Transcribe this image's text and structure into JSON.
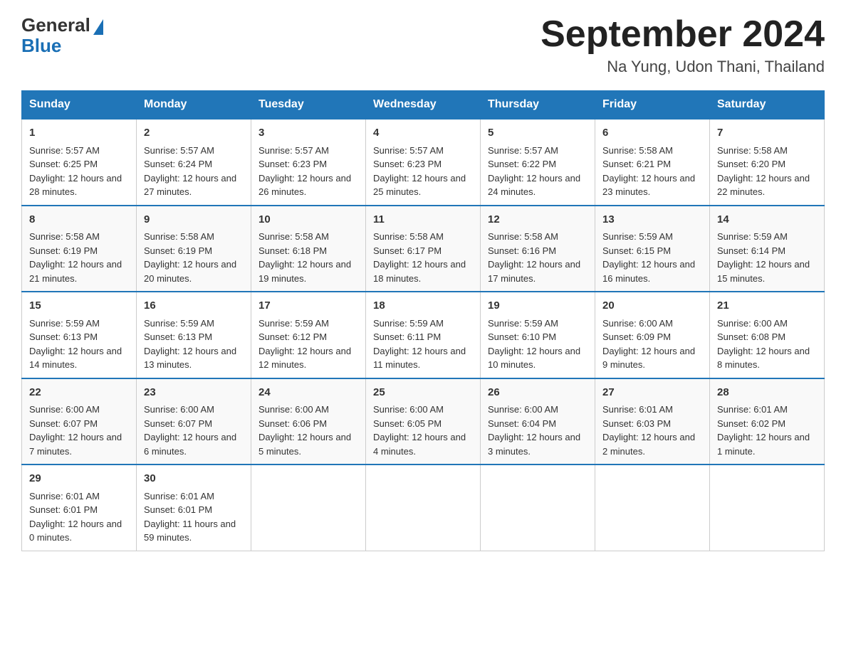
{
  "logo": {
    "general": "General",
    "blue": "Blue",
    "triangle_color": "#1a6fb5"
  },
  "header": {
    "title": "September 2024",
    "location": "Na Yung, Udon Thani, Thailand"
  },
  "weekdays": [
    "Sunday",
    "Monday",
    "Tuesday",
    "Wednesday",
    "Thursday",
    "Friday",
    "Saturday"
  ],
  "weeks": [
    [
      {
        "day": "1",
        "sunrise": "5:57 AM",
        "sunset": "6:25 PM",
        "daylight": "12 hours and 28 minutes."
      },
      {
        "day": "2",
        "sunrise": "5:57 AM",
        "sunset": "6:24 PM",
        "daylight": "12 hours and 27 minutes."
      },
      {
        "day": "3",
        "sunrise": "5:57 AM",
        "sunset": "6:23 PM",
        "daylight": "12 hours and 26 minutes."
      },
      {
        "day": "4",
        "sunrise": "5:57 AM",
        "sunset": "6:23 PM",
        "daylight": "12 hours and 25 minutes."
      },
      {
        "day": "5",
        "sunrise": "5:57 AM",
        "sunset": "6:22 PM",
        "daylight": "12 hours and 24 minutes."
      },
      {
        "day": "6",
        "sunrise": "5:58 AM",
        "sunset": "6:21 PM",
        "daylight": "12 hours and 23 minutes."
      },
      {
        "day": "7",
        "sunrise": "5:58 AM",
        "sunset": "6:20 PM",
        "daylight": "12 hours and 22 minutes."
      }
    ],
    [
      {
        "day": "8",
        "sunrise": "5:58 AM",
        "sunset": "6:19 PM",
        "daylight": "12 hours and 21 minutes."
      },
      {
        "day": "9",
        "sunrise": "5:58 AM",
        "sunset": "6:19 PM",
        "daylight": "12 hours and 20 minutes."
      },
      {
        "day": "10",
        "sunrise": "5:58 AM",
        "sunset": "6:18 PM",
        "daylight": "12 hours and 19 minutes."
      },
      {
        "day": "11",
        "sunrise": "5:58 AM",
        "sunset": "6:17 PM",
        "daylight": "12 hours and 18 minutes."
      },
      {
        "day": "12",
        "sunrise": "5:58 AM",
        "sunset": "6:16 PM",
        "daylight": "12 hours and 17 minutes."
      },
      {
        "day": "13",
        "sunrise": "5:59 AM",
        "sunset": "6:15 PM",
        "daylight": "12 hours and 16 minutes."
      },
      {
        "day": "14",
        "sunrise": "5:59 AM",
        "sunset": "6:14 PM",
        "daylight": "12 hours and 15 minutes."
      }
    ],
    [
      {
        "day": "15",
        "sunrise": "5:59 AM",
        "sunset": "6:13 PM",
        "daylight": "12 hours and 14 minutes."
      },
      {
        "day": "16",
        "sunrise": "5:59 AM",
        "sunset": "6:13 PM",
        "daylight": "12 hours and 13 minutes."
      },
      {
        "day": "17",
        "sunrise": "5:59 AM",
        "sunset": "6:12 PM",
        "daylight": "12 hours and 12 minutes."
      },
      {
        "day": "18",
        "sunrise": "5:59 AM",
        "sunset": "6:11 PM",
        "daylight": "12 hours and 11 minutes."
      },
      {
        "day": "19",
        "sunrise": "5:59 AM",
        "sunset": "6:10 PM",
        "daylight": "12 hours and 10 minutes."
      },
      {
        "day": "20",
        "sunrise": "6:00 AM",
        "sunset": "6:09 PM",
        "daylight": "12 hours and 9 minutes."
      },
      {
        "day": "21",
        "sunrise": "6:00 AM",
        "sunset": "6:08 PM",
        "daylight": "12 hours and 8 minutes."
      }
    ],
    [
      {
        "day": "22",
        "sunrise": "6:00 AM",
        "sunset": "6:07 PM",
        "daylight": "12 hours and 7 minutes."
      },
      {
        "day": "23",
        "sunrise": "6:00 AM",
        "sunset": "6:07 PM",
        "daylight": "12 hours and 6 minutes."
      },
      {
        "day": "24",
        "sunrise": "6:00 AM",
        "sunset": "6:06 PM",
        "daylight": "12 hours and 5 minutes."
      },
      {
        "day": "25",
        "sunrise": "6:00 AM",
        "sunset": "6:05 PM",
        "daylight": "12 hours and 4 minutes."
      },
      {
        "day": "26",
        "sunrise": "6:00 AM",
        "sunset": "6:04 PM",
        "daylight": "12 hours and 3 minutes."
      },
      {
        "day": "27",
        "sunrise": "6:01 AM",
        "sunset": "6:03 PM",
        "daylight": "12 hours and 2 minutes."
      },
      {
        "day": "28",
        "sunrise": "6:01 AM",
        "sunset": "6:02 PM",
        "daylight": "12 hours and 1 minute."
      }
    ],
    [
      {
        "day": "29",
        "sunrise": "6:01 AM",
        "sunset": "6:01 PM",
        "daylight": "12 hours and 0 minutes."
      },
      {
        "day": "30",
        "sunrise": "6:01 AM",
        "sunset": "6:01 PM",
        "daylight": "11 hours and 59 minutes."
      },
      null,
      null,
      null,
      null,
      null
    ]
  ],
  "labels": {
    "sunrise_prefix": "Sunrise: ",
    "sunset_prefix": "Sunset: ",
    "daylight_prefix": "Daylight: "
  }
}
